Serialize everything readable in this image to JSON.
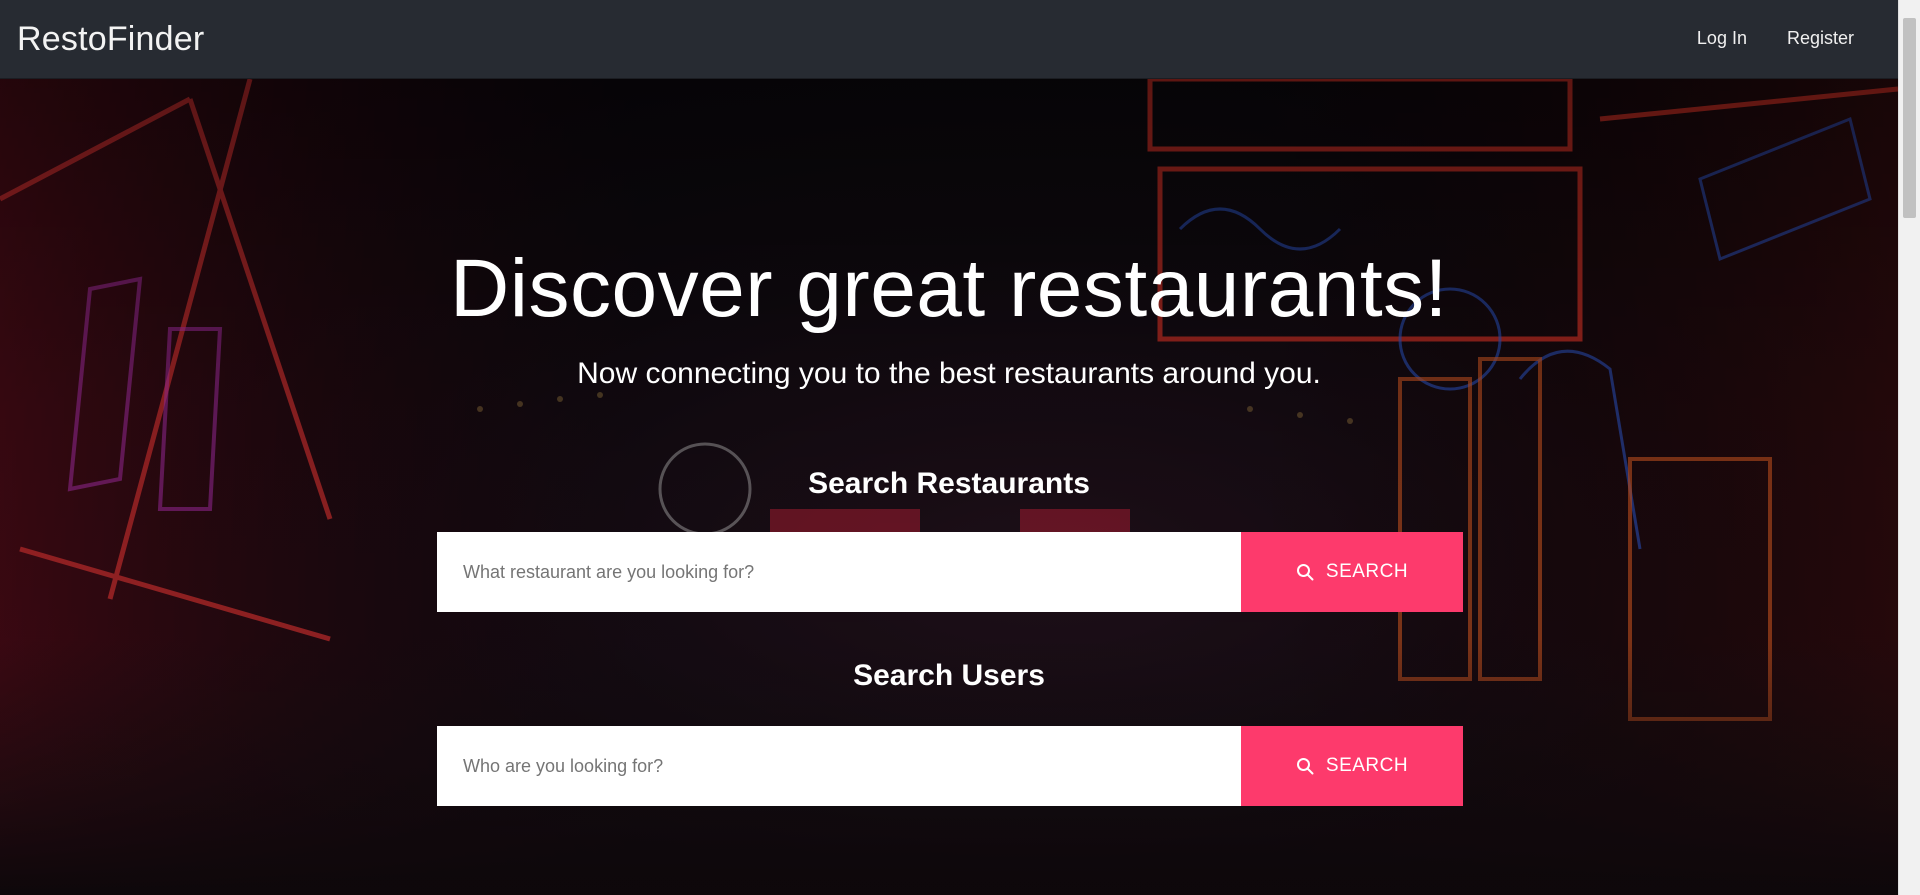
{
  "navbar": {
    "brand": "RestoFinder",
    "links": {
      "login": "Log In",
      "register": "Register"
    }
  },
  "hero": {
    "title": "Discover great restaurants!",
    "subtitle": "Now connecting you to the best restaurants around you."
  },
  "restaurant_search": {
    "label": "Search Restaurants",
    "placeholder": "What restaurant are you looking for?",
    "value": "",
    "button": "SEARCH"
  },
  "user_search": {
    "label": "Search Users",
    "placeholder": "Who are you looking for?",
    "value": "",
    "button": "SEARCH"
  },
  "colors": {
    "navbar": "#272b32",
    "accent": "#fd3a6c",
    "text": "#ffffff"
  },
  "icons": {
    "search": "search-icon"
  }
}
